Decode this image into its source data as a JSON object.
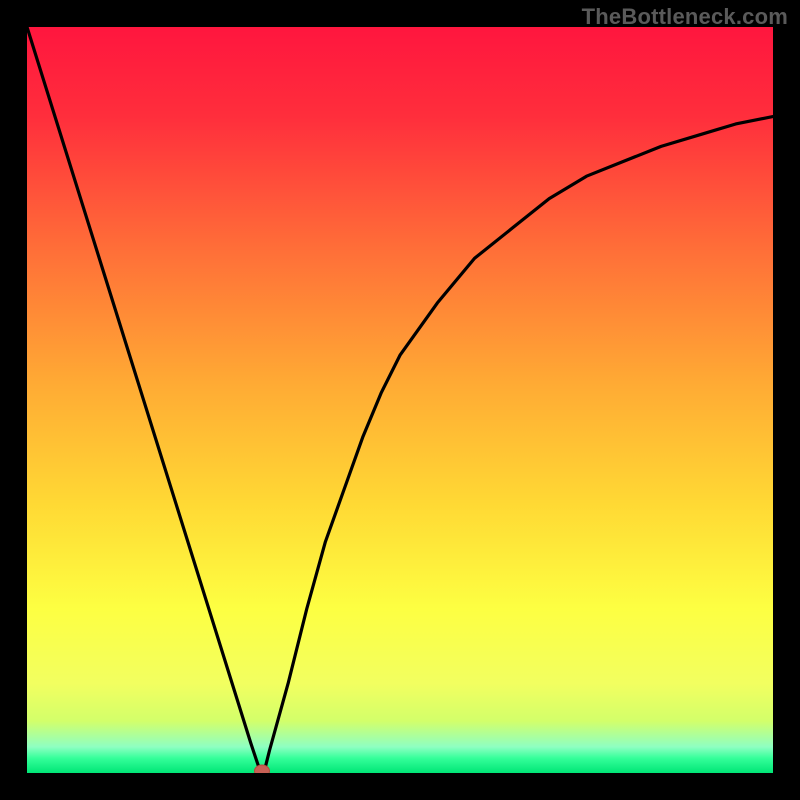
{
  "watermark": "TheBottleneck.com",
  "chart_data": {
    "type": "line",
    "title": "",
    "xlabel": "",
    "ylabel": "",
    "xlim": [
      0,
      100
    ],
    "ylim": [
      0,
      100
    ],
    "x": [
      0,
      2.5,
      5,
      7.5,
      10,
      12.5,
      15,
      17.5,
      20,
      22.5,
      25,
      27.5,
      30,
      31,
      31.5,
      32,
      32.5,
      35,
      37.5,
      40,
      42.5,
      45,
      47.5,
      50,
      55,
      60,
      65,
      70,
      75,
      80,
      85,
      90,
      95,
      100
    ],
    "values": [
      100,
      92,
      84,
      76,
      68,
      60,
      52,
      44,
      36,
      28,
      20,
      12,
      4,
      1,
      0,
      1,
      3,
      12,
      22,
      31,
      38,
      45,
      51,
      56,
      63,
      69,
      73,
      77,
      80,
      82,
      84,
      85.5,
      87,
      88
    ],
    "minimum_x": 31.5,
    "curve_description": "V-shaped curve: steep linear descent from (0,100) to minimum near x≈31.5, then asymptotic rise toward ~88 at x=100",
    "marker": {
      "x": 31.5,
      "y": 0,
      "color": "#c94a4a"
    },
    "background_gradient_top_to_bottom": [
      "#ff1a3c",
      "#ff5a3a",
      "#ffa63a",
      "#ffd93a",
      "#f6ff3a",
      "#c8ff5a",
      "#4cff8a",
      "#00e676"
    ],
    "green_band_y_range": [
      0,
      3
    ]
  }
}
